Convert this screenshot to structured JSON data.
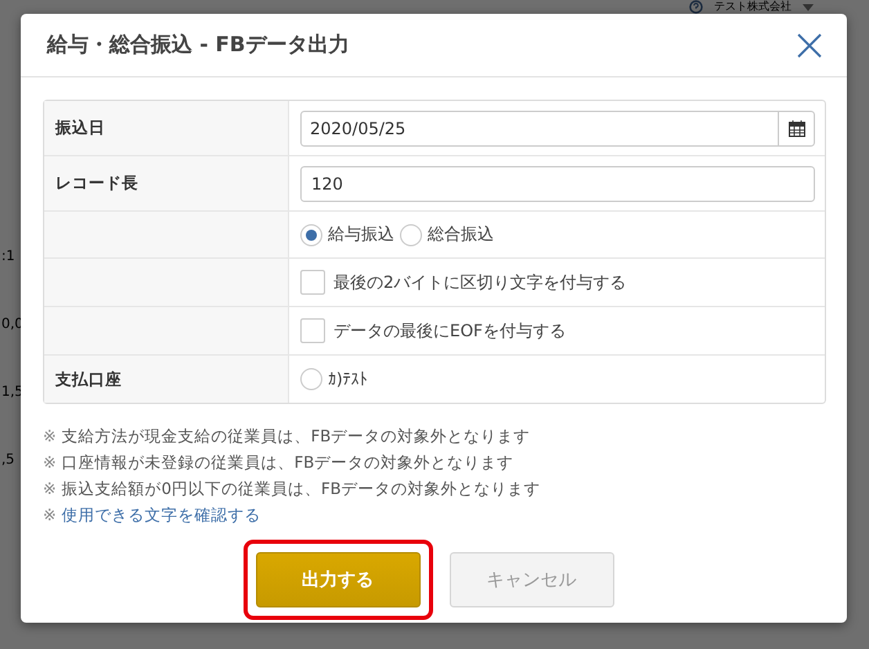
{
  "background": {
    "company": "テスト株式会社",
    "fragments": [
      ":1",
      "0,0",
      "1,5",
      ",5"
    ]
  },
  "dialog": {
    "title": "給与・総合振込 - FBデータ出力",
    "rows": [
      {
        "kind": "date",
        "label": "振込日",
        "value": "2020/05/25"
      },
      {
        "kind": "text",
        "label": "レコード長",
        "value": "120"
      },
      {
        "kind": "radios",
        "label": "",
        "options": [
          {
            "label": "給与振込",
            "selected": true
          },
          {
            "label": "総合振込",
            "selected": false
          }
        ]
      },
      {
        "kind": "checkbox",
        "label": "",
        "text": "最後の2バイトに区切り文字を付与する",
        "checked": false
      },
      {
        "kind": "checkbox",
        "label": "",
        "text": "データの最後にEOFを付与する",
        "checked": false
      },
      {
        "kind": "radios",
        "label": "支払口座",
        "options": [
          {
            "label": "ｶ)ﾃｽﾄ",
            "selected": false
          }
        ]
      }
    ],
    "notes": [
      {
        "kind": "text",
        "mark": "※",
        "text": "支給方法が現金支給の従業員は、FBデータの対象外となります"
      },
      {
        "kind": "text",
        "mark": "※",
        "text": "口座情報が未登録の従業員は、FBデータの対象外となります"
      },
      {
        "kind": "text",
        "mark": "※",
        "text": "振込支給額が0円以下の従業員は、FBデータの対象外となります"
      },
      {
        "kind": "link",
        "mark": "※",
        "text": "使用できる文字を確認する"
      }
    ],
    "buttons": [
      {
        "kind": "primary",
        "label": "出力する",
        "highlighted": true
      },
      {
        "kind": "secondary",
        "label": "キャンセル",
        "highlighted": false
      }
    ]
  }
}
